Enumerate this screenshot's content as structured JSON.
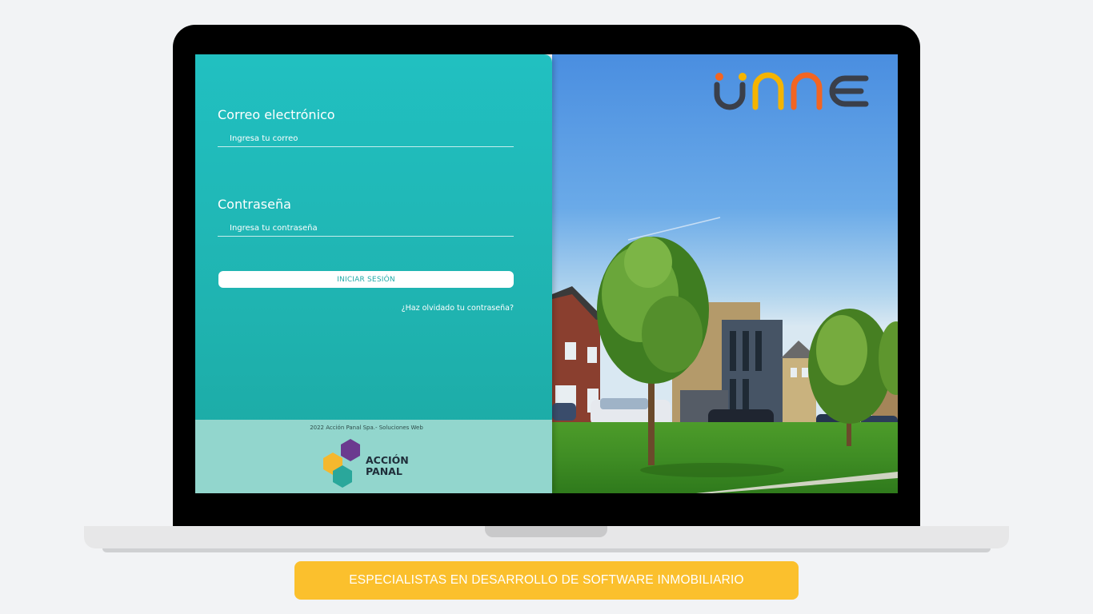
{
  "login": {
    "email_label": "Correo electrónico",
    "email_placeholder": "Ingresa tu correo",
    "password_label": "Contraseña",
    "password_placeholder": "Ingresa tu contraseña",
    "login_button": "INICIAR SESIÓN",
    "forgot_password": "¿Haz olvidado tu contraseña?"
  },
  "footer": {
    "copyright": "2022 Acción Panal Spa.- Soluciones Web",
    "partner_line1": "ACCIÓN",
    "partner_line2": "PANAL"
  },
  "brand": {
    "logo_text": "unne",
    "colors": {
      "u": "#3a3f4a",
      "accent_yellow": "#f5b400",
      "accent_orange": "#f26522",
      "e": "#3a3f4a"
    }
  },
  "tagline": "ESPECIALISTAS EN DESARROLLO DE SOFTWARE INMOBILIARIO",
  "colors": {
    "panel_teal": "#21c0c1",
    "footer_teal": "#92d6cd",
    "tagline_yellow": "#fbc02d"
  }
}
